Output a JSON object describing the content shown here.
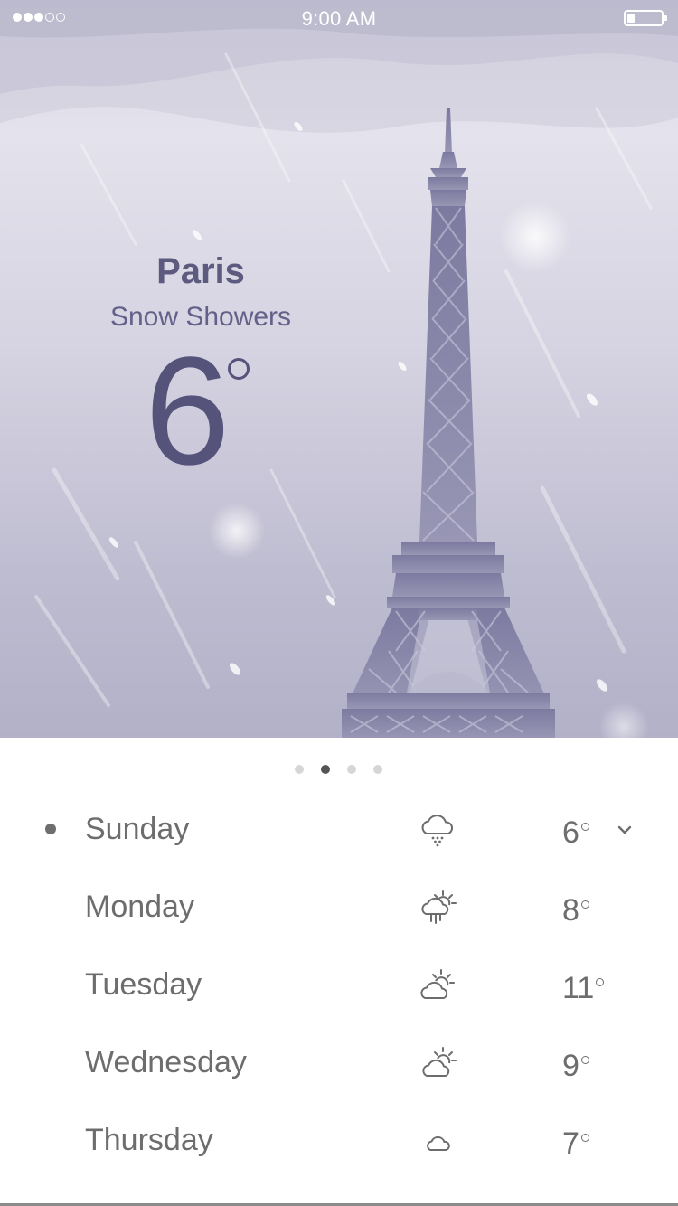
{
  "status_bar": {
    "time": "9:00 AM",
    "signal_bars_filled": 3,
    "signal_bars_total": 5
  },
  "current": {
    "city": "Paris",
    "condition": "Snow Showers",
    "temperature": "6"
  },
  "pager": {
    "count": 4,
    "active_index": 1
  },
  "forecast": [
    {
      "day": "Sunday",
      "temp": "6",
      "icon": "snow-cloud-icon",
      "selected": true
    },
    {
      "day": "Monday",
      "temp": "8",
      "icon": "sun-rain-cloud-icon",
      "selected": false
    },
    {
      "day": "Tuesday",
      "temp": "11",
      "icon": "partly-cloudy-icon",
      "selected": false
    },
    {
      "day": "Wednesday",
      "temp": "9",
      "icon": "partly-cloudy-icon",
      "selected": false
    },
    {
      "day": "Thursday",
      "temp": "7",
      "icon": "cloud-icon",
      "selected": false
    }
  ],
  "colors": {
    "accent": "#5c5a7e",
    "tower": "#8987a8",
    "text_gray": "#6d6d6d"
  }
}
